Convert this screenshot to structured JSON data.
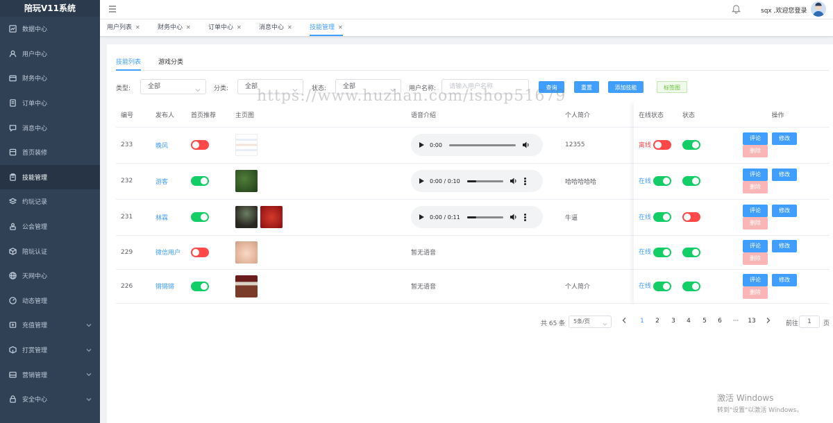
{
  "app": {
    "title": "陪玩V11系统"
  },
  "sidebar": {
    "items": [
      {
        "label": "数据中心",
        "icon": "chart-icon"
      },
      {
        "label": "用户中心",
        "icon": "user-icon"
      },
      {
        "label": "财务中心",
        "icon": "wallet-icon"
      },
      {
        "label": "订单中心",
        "icon": "order-icon"
      },
      {
        "label": "消息中心",
        "icon": "message-icon"
      },
      {
        "label": "首页装修",
        "icon": "home-icon"
      },
      {
        "label": "技能管理",
        "icon": "clipboard-icon"
      },
      {
        "label": "约玩记录",
        "icon": "layers-icon"
      },
      {
        "label": "公会管理",
        "icon": "guild-icon"
      },
      {
        "label": "陪玩认证",
        "icon": "box-icon"
      },
      {
        "label": "天网中心",
        "icon": "globe-icon"
      },
      {
        "label": "动态管理",
        "icon": "dashboard-icon"
      },
      {
        "label": "充值管理",
        "icon": "recharge-icon"
      },
      {
        "label": "打赏管理",
        "icon": "gift-icon"
      },
      {
        "label": "营销管理",
        "icon": "marketing-icon"
      },
      {
        "label": "安全中心",
        "icon": "lock-icon"
      }
    ],
    "active_index": 6
  },
  "header": {
    "welcome": "sqx ,欢迎您登录"
  },
  "view_tabs": [
    {
      "label": "用户列表"
    },
    {
      "label": "财务中心"
    },
    {
      "label": "订单中心"
    },
    {
      "label": "消息中心"
    },
    {
      "label": "技能管理"
    }
  ],
  "sub_tabs": {
    "skill_list": "技能列表",
    "game_category": "游戏分类"
  },
  "filters": {
    "type_label": "类型:",
    "type_value": "全部",
    "category_label": "分类:",
    "category_value": "全部",
    "status_label": "状态:",
    "status_value": "全部",
    "username_label": "用户名称:",
    "username_placeholder": "请输入用户名称",
    "query": "查询",
    "reset": "重置",
    "add_skill": "添加技能",
    "tag_icon_btn": "标签图"
  },
  "table": {
    "columns": [
      "编号",
      "发布人",
      "首页推荐",
      "主页图",
      "语音介绍",
      "个人简介",
      "在线状态",
      "状态",
      "操作"
    ],
    "rows": [
      {
        "id": "233",
        "publisher": "晚风",
        "recommend": false,
        "audio": "0:00",
        "audio_progress": 0,
        "bio": "12355",
        "online_label": "离线",
        "online": false,
        "status": true
      },
      {
        "id": "232",
        "publisher": "游客",
        "recommend": true,
        "audio": "0:00 / 0:10",
        "audio_progress": 0.25,
        "bio": "哈哈哈哈哈",
        "online_label": "在线",
        "online": true,
        "status": true
      },
      {
        "id": "231",
        "publisher": "林霖",
        "recommend": true,
        "audio": "0:00 / 0:11",
        "audio_progress": 0.25,
        "bio": "牛逼",
        "online_label": "在线",
        "online": true,
        "status": false
      },
      {
        "id": "229",
        "publisher": "微信用户",
        "recommend": false,
        "audio_text": "暂无语音",
        "bio": "",
        "online_label": "在线",
        "online": true,
        "status": true
      },
      {
        "id": "226",
        "publisher": "锵锵锵",
        "recommend": true,
        "audio_text": "暂无语音",
        "bio": "个人简介",
        "online_label": "在线",
        "online": true,
        "status": true
      }
    ],
    "actions": {
      "comment": "评论",
      "edit": "修改",
      "delete": "删除"
    }
  },
  "pagination": {
    "total": "共 65 条",
    "page_size": "5条/页",
    "pages": [
      "1",
      "2",
      "3",
      "4",
      "5",
      "6",
      "···",
      "13"
    ],
    "current": "1",
    "goto_label": "前往",
    "goto_value": "1",
    "goto_suffix": "页"
  },
  "overlay": {
    "watermark": "https://www.huzhan.com/ishop51679",
    "activate_title": "激活 Windows",
    "activate_sub": "转到\"设置\"以激活 Windows。"
  },
  "colors": {
    "primary": "#409eff",
    "sidebar": "#304156",
    "switch_on": "#13ce66",
    "switch_off": "#ff4949"
  }
}
